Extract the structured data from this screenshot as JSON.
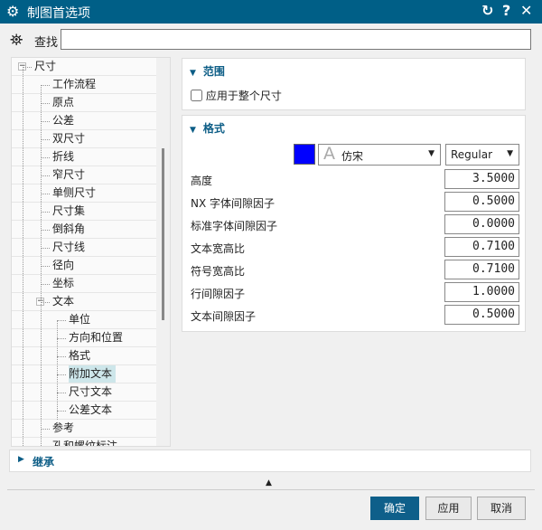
{
  "title": "制图首选项",
  "title_buttons": {
    "reset": "↻",
    "help": "?",
    "close": "✕"
  },
  "search": {
    "label": "查找",
    "value": "",
    "placeholder": ""
  },
  "tree": {
    "items": [
      {
        "label": "尺寸",
        "level": 0
      },
      {
        "label": "工作流程",
        "level": 1
      },
      {
        "label": "原点",
        "level": 1
      },
      {
        "label": "公差",
        "level": 1
      },
      {
        "label": "双尺寸",
        "level": 1
      },
      {
        "label": "折线",
        "level": 1
      },
      {
        "label": "窄尺寸",
        "level": 1
      },
      {
        "label": "单侧尺寸",
        "level": 1
      },
      {
        "label": "尺寸集",
        "level": 1
      },
      {
        "label": "倒斜角",
        "level": 1
      },
      {
        "label": "尺寸线",
        "level": 1
      },
      {
        "label": "径向",
        "level": 1
      },
      {
        "label": "坐标",
        "level": 1
      },
      {
        "label": "文本",
        "level": 1
      },
      {
        "label": "单位",
        "level": 2
      },
      {
        "label": "方向和位置",
        "level": 2
      },
      {
        "label": "格式",
        "level": 2
      },
      {
        "label": "附加文本",
        "level": 2,
        "selected": true
      },
      {
        "label": "尺寸文本",
        "level": 2
      },
      {
        "label": "公差文本",
        "level": 2
      },
      {
        "label": "参考",
        "level": 1
      },
      {
        "label": "孔和螺纹标注",
        "level": 1
      }
    ]
  },
  "range": {
    "header": "范围",
    "checkbox_label": "应用于整个尺寸",
    "checked": false
  },
  "format": {
    "header": "格式",
    "color": "#0000ff",
    "font": "仿宋",
    "style": "Regular",
    "fields": [
      {
        "label": "高度",
        "value": "3.5000"
      },
      {
        "label": "NX 字体间隙因子",
        "value": "0.5000"
      },
      {
        "label": "标准字体间隙因子",
        "value": "0.0000"
      },
      {
        "label": "文本宽高比",
        "value": "0.7100"
      },
      {
        "label": "符号宽高比",
        "value": "0.7100"
      },
      {
        "label": "行间隙因子",
        "value": "1.0000"
      },
      {
        "label": "文本间隙因子",
        "value": "0.5000"
      }
    ]
  },
  "inherit": {
    "header": "继承"
  },
  "buttons": {
    "ok": "确定",
    "apply": "应用",
    "cancel": "取消"
  }
}
